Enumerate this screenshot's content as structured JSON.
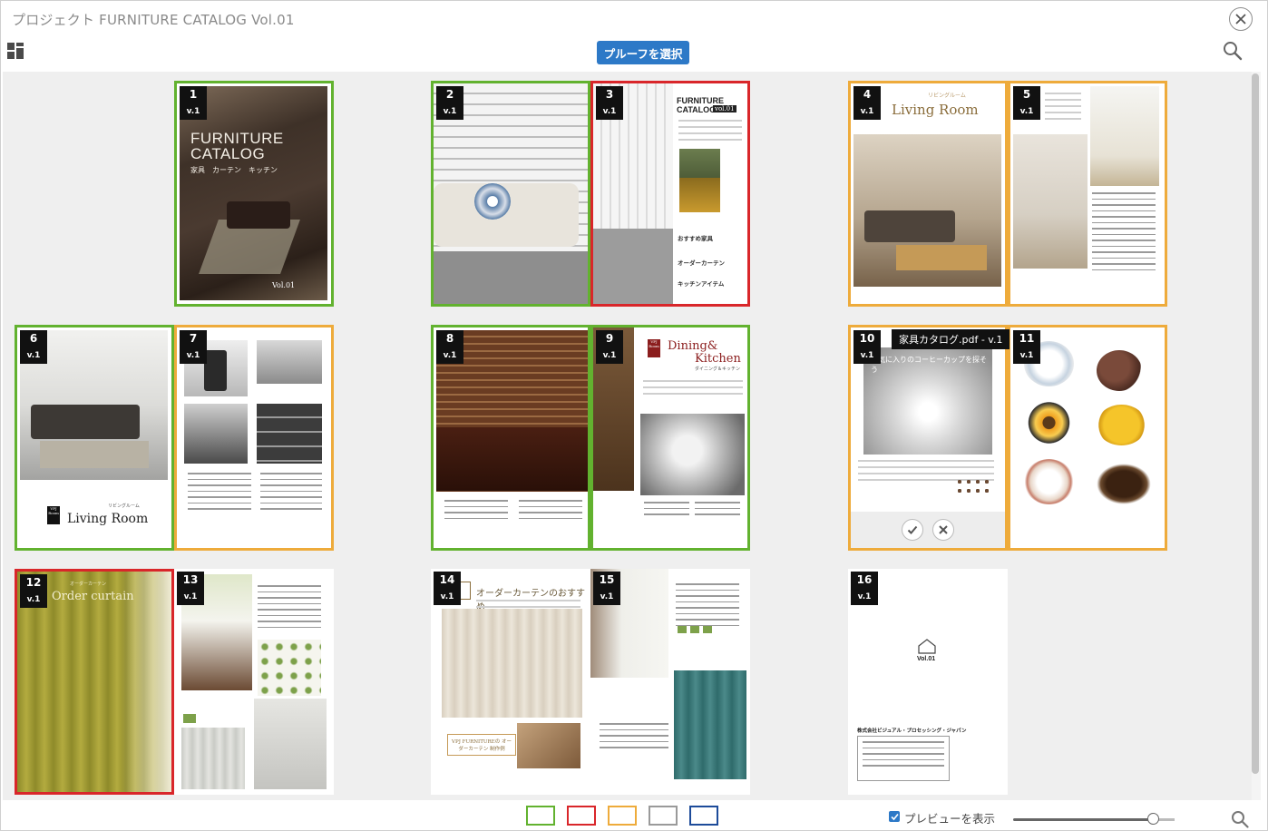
{
  "window": {
    "title": "プロジェクト FURNITURE CATALOG Vol.01"
  },
  "toolbar": {
    "proof_button": "プルーフを選択"
  },
  "pages": [
    {
      "num": "1",
      "ver": "v.1",
      "status": "green"
    },
    {
      "num": "2",
      "ver": "v.1",
      "status": "green"
    },
    {
      "num": "3",
      "ver": "v.1",
      "status": "red"
    },
    {
      "num": "4",
      "ver": "v.1",
      "status": "orange"
    },
    {
      "num": "5",
      "ver": "v.1",
      "status": "orange"
    },
    {
      "num": "6",
      "ver": "v.1",
      "status": "green"
    },
    {
      "num": "7",
      "ver": "v.1",
      "status": "orange"
    },
    {
      "num": "8",
      "ver": "v.1",
      "status": "green"
    },
    {
      "num": "9",
      "ver": "v.1",
      "status": "green"
    },
    {
      "num": "10",
      "ver": "v.1",
      "status": "orange"
    },
    {
      "num": "11",
      "ver": "v.1",
      "status": "orange"
    },
    {
      "num": "12",
      "ver": "v.1",
      "status": "red"
    },
    {
      "num": "13",
      "ver": "v.1",
      "status": "none"
    },
    {
      "num": "14",
      "ver": "v.1",
      "status": "none"
    },
    {
      "num": "15",
      "ver": "v.1",
      "status": "none"
    },
    {
      "num": "16",
      "ver": "v.1",
      "status": "none"
    }
  ],
  "page_text": {
    "p1_title": "FURNITURE CATALOG",
    "p1_sub": "家具　カーテン　キッチン",
    "p1_vol": "Vol.01",
    "p3_title1": "FURNITURE",
    "p3_title2": "CATALOG",
    "p3_vol": "vol.01",
    "p3_toc1": "おすすめ家具",
    "p3_toc2": "オーダーカーテン",
    "p3_toc3": "キッチンアイテム",
    "p4_kana": "リビングルーム",
    "p4_title": "Living Room",
    "p6_kana": "リビングルーム",
    "p6_title": "Living Room",
    "p6_logo": "VPJ Room",
    "p9_title1": "Dining&",
    "p9_title2": "Kitchen",
    "p9_kana": "ダイニング＆キッチン",
    "p9_logo": "VPJ Room",
    "p10_heading": "お気に入りのコーヒーカップを探そう",
    "p12_kana": "オーダーカーテン",
    "p12_title": "Order curtain",
    "p14_title": "オーダーカーテンのおすすめ",
    "p14_sub": "VPJ FURNITUREの オーダーカーテン 制作例",
    "p16_vol": "Vol.01",
    "p16_company": "株式会社ビジュアル・プロセッシング・ジャパン"
  },
  "preview_tooltip": "家具カタログ.pdf - v.1",
  "status_colors": {
    "green": "#62b22f",
    "red": "#d9262a",
    "orange": "#eeab3b",
    "gray": "#9a9a9a",
    "blue": "#1d4b9a"
  },
  "footer": {
    "preview_label": "プレビューを表示",
    "zoom_level": 0.87
  }
}
